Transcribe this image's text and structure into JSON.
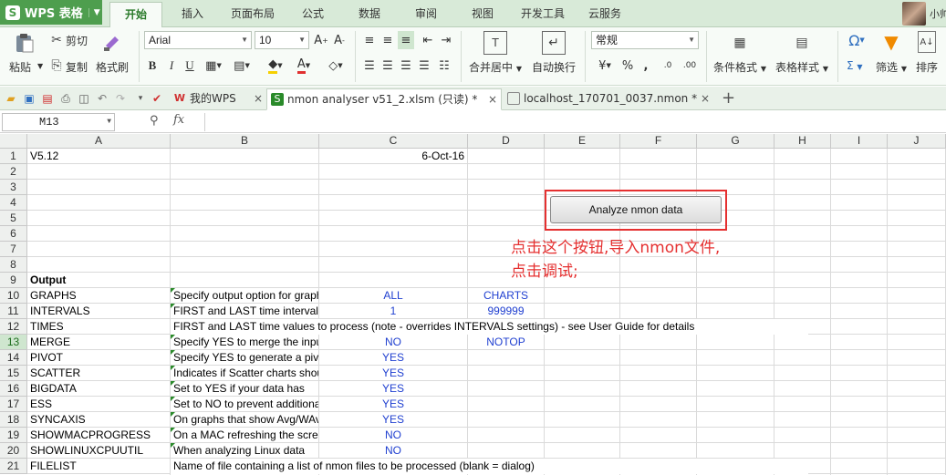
{
  "app": {
    "name": "WPS 表格",
    "logo": "S"
  },
  "menu": {
    "tabs": [
      {
        "label": "开始",
        "active": true
      },
      {
        "label": "插入"
      },
      {
        "label": "页面布局"
      },
      {
        "label": "公式"
      },
      {
        "label": "数据"
      },
      {
        "label": "审阅"
      },
      {
        "label": "视图"
      },
      {
        "label": "开发工具"
      },
      {
        "label": "云服务"
      }
    ]
  },
  "user": {
    "name": "小帅"
  },
  "ribbon": {
    "paste": "粘贴",
    "cut": "剪切",
    "copy": "复制",
    "format_painter": "格式刷",
    "font_name": "Arial",
    "font_size": "10",
    "bold": "B",
    "italic": "I",
    "underline": "U",
    "merge_center": "合并居中",
    "auto_wrap": "自动换行",
    "number_format": "常规",
    "percent": "%",
    "comma": ",",
    "conditional_format": "条件格式",
    "table_style": "表格样式",
    "sum": "Σ",
    "filter": "筛选",
    "sort": "排序"
  },
  "doc_tabs": [
    {
      "label": "我的WPS",
      "active": false
    },
    {
      "label": "nmon analyser v51_2.xlsm (只读) *",
      "active": true
    },
    {
      "label": "localhost_170701_0037.nmon *",
      "active": false
    }
  ],
  "formula_bar": {
    "cell_ref": "M13",
    "fx": "fx",
    "formula": ""
  },
  "columns": [
    "A",
    "B",
    "C",
    "D",
    "E",
    "F",
    "G",
    "H",
    "I",
    "J"
  ],
  "rows": [
    "1",
    "2",
    "3",
    "4",
    "5",
    "6",
    "7",
    "8",
    "9",
    "10",
    "11",
    "12",
    "13",
    "14",
    "15",
    "16",
    "17",
    "18",
    "19",
    "20",
    "21"
  ],
  "cells": {
    "A1": "V5.12",
    "C1": "6-Oct-16",
    "A9": "Output",
    "A10": "GRAPHS",
    "B10": "Specify output option for graphs",
    "C10": "ALL",
    "D10": "CHARTS",
    "A11": "INTERVALS",
    "B11": "FIRST and LAST time intervals",
    "C11": "1",
    "D11": "999999",
    "A12": "TIMES",
    "B12": "FIRST and LAST time values to process (note - overrides INTERVALS settings) - see User Guide for details",
    "A13": "MERGE",
    "B13": "Specify YES to merge the input",
    "C13": "NO",
    "D13": "NOTOP",
    "A14": "PIVOT",
    "B14": "Specify YES to generate a pivot",
    "C14": "YES",
    "A15": "SCATTER",
    "B15": "Indicates if Scatter charts should",
    "C15": "YES",
    "A16": "BIGDATA",
    "B16": "Set to YES if your data has",
    "C16": "YES",
    "A17": "ESS",
    "B17": "Set to NO to prevent additional",
    "C17": "YES",
    "A18": "SYNCAXIS",
    "B18": "On graphs that show Avg/WAvg",
    "C18": "YES",
    "A19": "SHOWMACPROGRESS",
    "B19": "On a MAC refreshing the screen",
    "C19": "NO",
    "A20": "SHOWLINUXCPUUTIL",
    "B20": "When analyzing Linux data",
    "C20": "NO",
    "A21": "FILELIST",
    "B21": "Name of file containing a list of nmon files to be processed (blank = dialog)"
  },
  "button": {
    "label": "Analyze nmon data"
  },
  "note": {
    "line1": "点击这个按钮,导入nmon文件,",
    "line2": "点击调试;"
  },
  "colors": {
    "accent": "#4e9e4e",
    "annotation_red": "#e53030",
    "value_blue": "#1f3fd0"
  }
}
